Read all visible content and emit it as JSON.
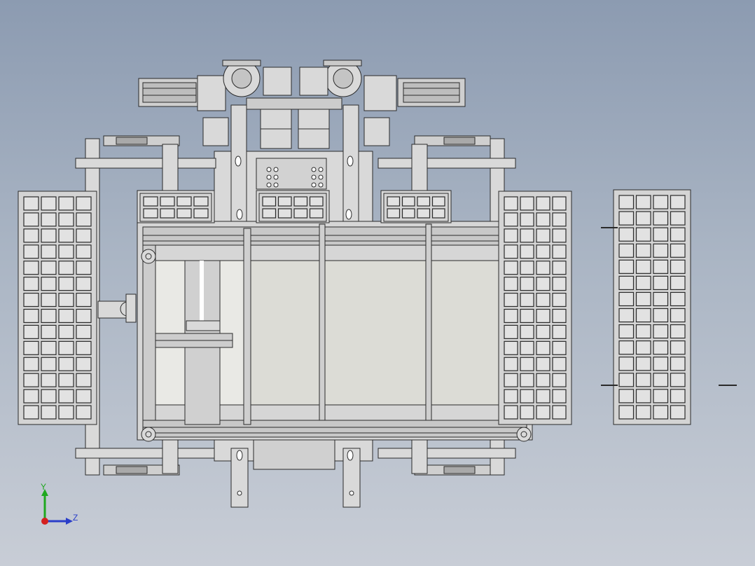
{
  "viewport": {
    "background_top": "#8c9bb1",
    "background_bottom": "#c8cdd6",
    "model_fill": "#d9d9d9",
    "model_stroke": "#2a2a2a"
  },
  "triad": {
    "y_label": "Y",
    "z_label": "Z",
    "y_color": "#1fa81f",
    "z_color": "#2a3ec9",
    "x_color": "#d42020"
  }
}
